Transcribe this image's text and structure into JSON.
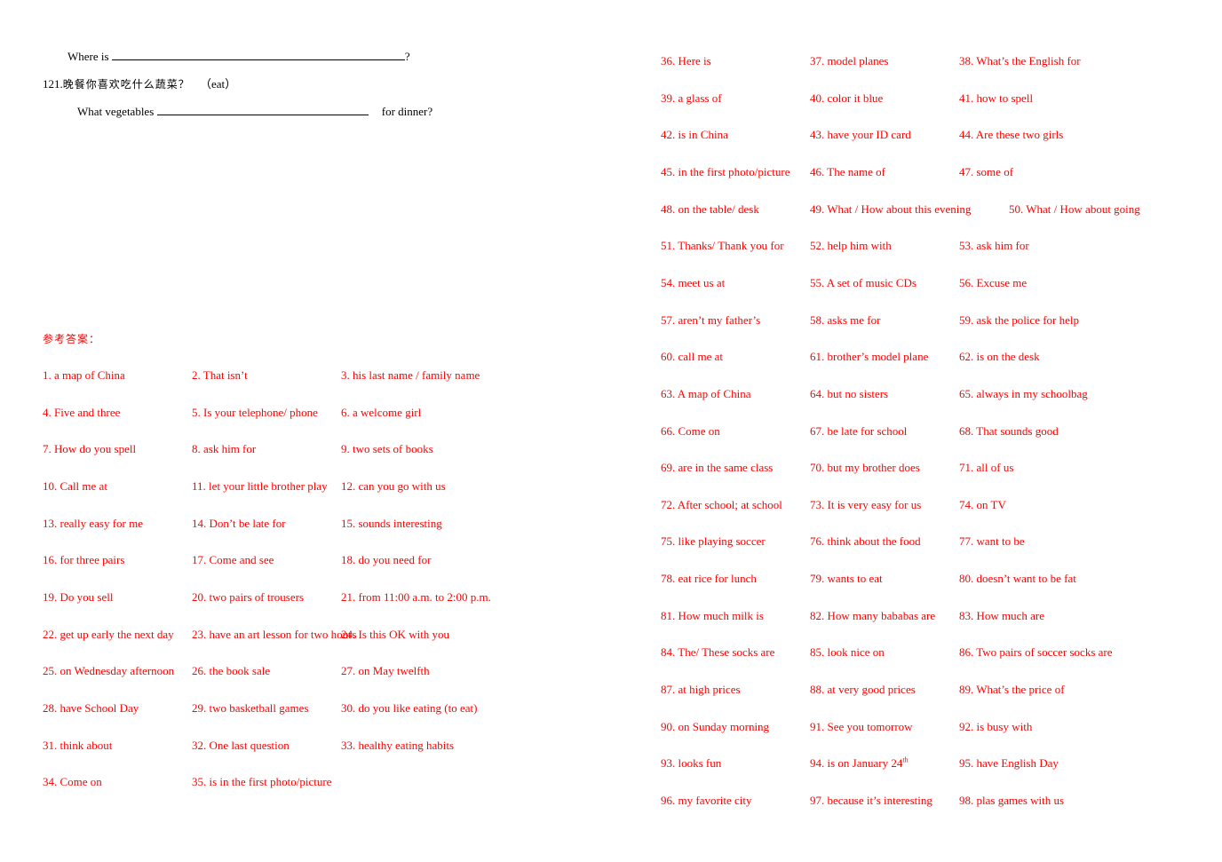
{
  "questions": {
    "q120_line": {
      "prefix": "Where is",
      "suffix": "?"
    },
    "q121": {
      "number": "121.",
      "chinese": "晚餐你喜欢吃什么蔬菜？",
      "hint": "（eat）",
      "prefix": "What vegetables",
      "suffix": "for dinner?"
    }
  },
  "answers": {
    "title": "参考答案：",
    "color": "#ff0000",
    "left_items": [
      "1. a map of China",
      "2. That isn’t",
      "3. his last name / family name",
      "4. Five and three",
      "5. Is your telephone/ phone",
      "6. a welcome girl",
      "7. How do you spell",
      "8. ask him for",
      "9. two sets of books",
      "10. Call me at",
      "11. let your little brother play",
      "12. can you go with us",
      "13. really easy for me",
      "14. Don’t be late for",
      "15. sounds interesting",
      "16. for three pairs",
      "17. Come and see",
      "18. do you need for",
      "19. Do you sell",
      "20. two pairs of trousers",
      "21. from 11:00 a.m. to 2:00 p.m.",
      "22. get up early the next day",
      "23. have an art lesson for two hours",
      "24. Is this OK with you",
      "25. on Wednesday afternoon",
      "26. the book sale",
      "27. on May twelfth",
      "28. have School Day",
      "29. two basketball games",
      "30. do you like eating (to eat)",
      "31. think about",
      "32. One last question",
      "33. healthy eating habits",
      "34. Come on",
      "35. is in the first photo/picture"
    ],
    "right_items": [
      "36. Here is",
      "37. model planes",
      "38. What’s the English for",
      "39. a glass of",
      "40. color it blue",
      "41. how to spell",
      "42. is in China",
      "43. have your ID card",
      "44. Are these two girls",
      "45. in the first photo/picture",
      "46. The name of",
      "47. some of",
      "48. on the table/ desk",
      "49. What / How about this evening",
      "50. What / How about going",
      "51. Thanks/ Thank you for",
      "52. help him with",
      "53. ask him for",
      "54. meet us at",
      "55. A set of music CDs",
      "56. Excuse me",
      "57. aren’t my father’s",
      "58. asks me for",
      "59. ask the police for help",
      "60. call me at",
      "61. brother’s model plane",
      "62. is on the desk",
      "63. A map of China",
      "64. but no sisters",
      "65. always in my schoolbag",
      "66. Come on",
      "67. be late for school",
      "68. That sounds good",
      "69. are in the same class",
      "70. but my brother does",
      "71. all of us",
      "72. After school; at school",
      "73. It is very easy for us",
      "74. on TV",
      "75. like playing soccer",
      "76. think about the food",
      "77. want to be",
      "78. eat rice for lunch",
      "79. wants to eat",
      "80. doesn’t want to be fat",
      "81. How much milk is",
      "82. How many bababas are",
      "83. How much are",
      "84. The/ These socks are",
      "85. look nice on",
      "86. Two pairs of soccer socks are",
      "87. at high prices",
      "88. at very good prices",
      "89. What’s the price of",
      "90. on Sunday morning",
      "91. See you tomorrow",
      "92. is busy with",
      "93. looks fun",
      "94. is on January 24",
      "95. have English Day",
      "96. my favorite city",
      "97. because it’s interesting",
      "98. plas games with us"
    ],
    "item94_superscript": "th"
  }
}
